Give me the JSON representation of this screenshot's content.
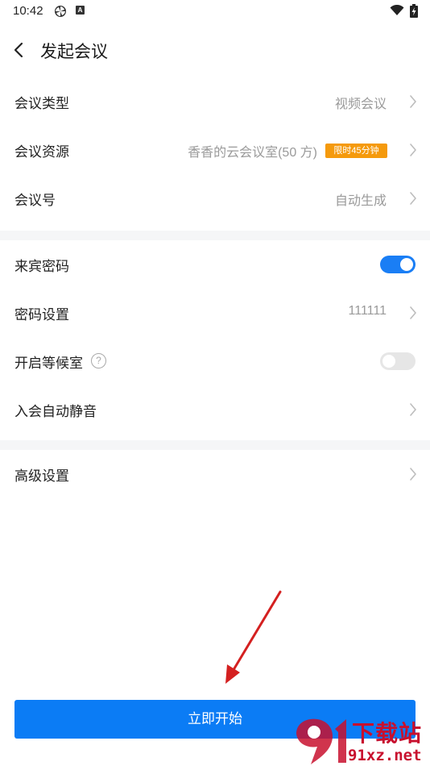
{
  "status_bar": {
    "time": "10:42",
    "icons": [
      "pinwheel-icon",
      "a-icon",
      "wifi-icon",
      "battery-icon"
    ]
  },
  "header": {
    "title": "发起会议",
    "back_icon": "chevron-left-icon"
  },
  "settings": {
    "meeting_type": {
      "label": "会议类型",
      "value": "视频会议"
    },
    "meeting_resource": {
      "label": "会议资源",
      "value": "香香的云会议室(50 方)",
      "badge": "限时45分钟"
    },
    "meeting_number": {
      "label": "会议号",
      "value": "自动生成"
    },
    "guest_password": {
      "label": "来宾密码",
      "enabled": true
    },
    "password_setting": {
      "label": "密码设置",
      "value": "111111"
    },
    "waiting_room": {
      "label": "开启等候室",
      "help": "?",
      "enabled": false
    },
    "join_mute": {
      "label": "入会自动静音"
    },
    "advanced": {
      "label": "高级设置"
    }
  },
  "start_button": {
    "label": "立即开始"
  },
  "watermark": {
    "brand": "下载站",
    "url": "91xz.net"
  },
  "colors": {
    "accent": "#0b7cf5",
    "toggle_on": "#1a7ef5",
    "badge": "#f59a0c",
    "annotation_arrow": "#d42020",
    "watermark": "#c8102e"
  }
}
